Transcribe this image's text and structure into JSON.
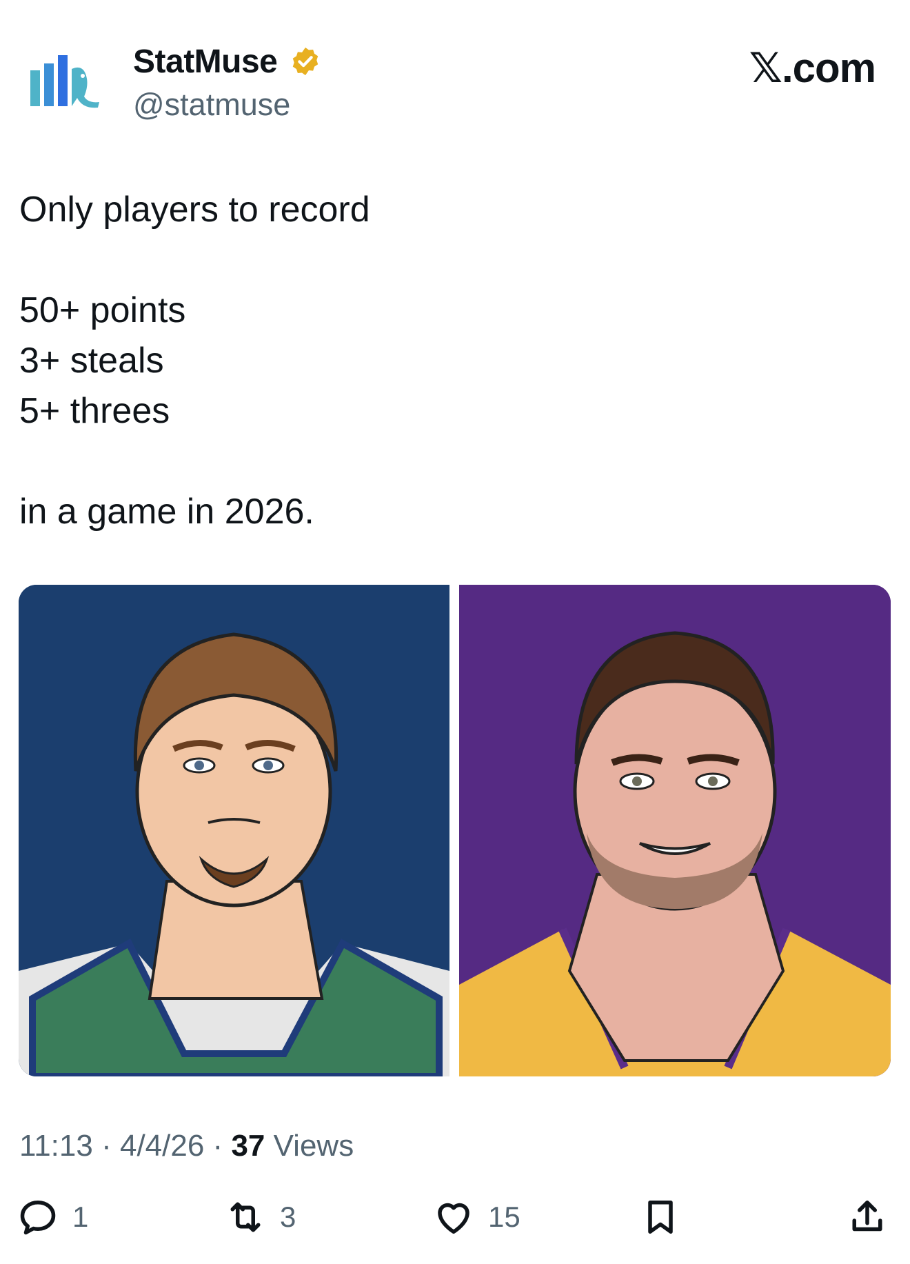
{
  "author": {
    "display_name": "StatMuse",
    "handle": "@statmuse",
    "verified": true,
    "verified_color": "#e8b021"
  },
  "brand": "𝕏.com",
  "tweet": {
    "text": "Only players to record\n\n50+ points\n3+ steals\n5+ threes\n\nin a game in 2026."
  },
  "media": {
    "left": {
      "background": "#1b3e6e",
      "jersey_color": "#3a7d5a"
    },
    "right": {
      "background": "#552a83",
      "jersey_color": "#f0b944"
    }
  },
  "meta": {
    "time": "11:13",
    "date": "4/4/26",
    "views_count": "37",
    "views_label": "Views"
  },
  "actions": {
    "reply": {
      "icon": "reply-icon",
      "count": "1"
    },
    "repost": {
      "icon": "repost-icon",
      "count": "3"
    },
    "like": {
      "icon": "heart-icon",
      "count": "15"
    },
    "bookmark": {
      "icon": "bookmark-icon"
    },
    "share": {
      "icon": "share-icon"
    }
  }
}
